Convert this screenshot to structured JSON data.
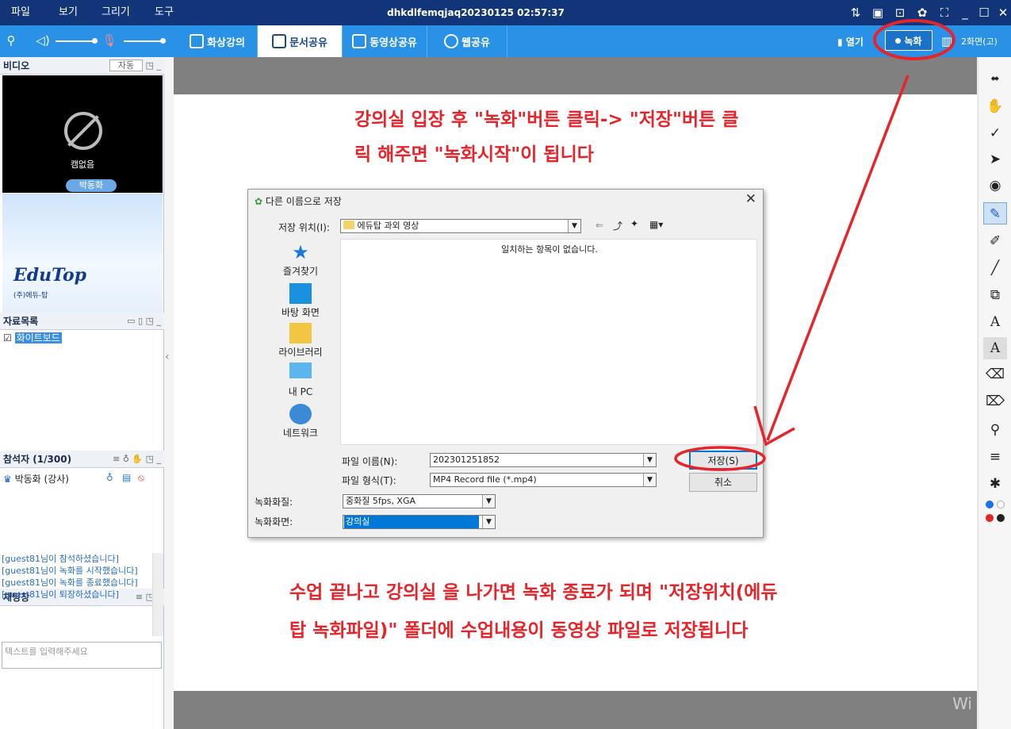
{
  "titlebar": {
    "menu": [
      "파일",
      "보기",
      "그리기",
      "도구"
    ],
    "title": "dhkdlfemqjaq20230125 02:57:37"
  },
  "toolbar": {
    "tabs": [
      "화상강의",
      "문서공유",
      "동영상공유",
      "웹공유"
    ],
    "active_tab": "문서공유",
    "open_label": "열기",
    "record_label": "녹화",
    "screen_label": "2화면(고)"
  },
  "video_panel": {
    "title": "비디오",
    "mode": "자동",
    "caption": "캠없음",
    "name": "박동화",
    "logo": "EduTop",
    "logo_sub": "(주)에듀-탑"
  },
  "materials_panel": {
    "title": "자료목록",
    "items": [
      "화이트보드"
    ]
  },
  "participants_panel": {
    "title": "참석자 (1/300)",
    "items": [
      "박동화 (강사)"
    ]
  },
  "chat_panel": {
    "title": "채팅창",
    "messages": [
      "[guest81님이 참석하셨습니다]",
      "[guest81님이 녹화를 시작했습니다]",
      "[guest81님이 녹화를 종료했습니다]",
      "[guest81님이 퇴장하셨습니다]"
    ],
    "input_placeholder": "텍스트를 입력해주세요"
  },
  "annotations": {
    "top_line1": "강의실 입장 후 \"녹화\"버튼 클릭-> \"저장\"버튼 클",
    "top_line2": "릭 해주면 \"녹화시작\"이 됩니다",
    "bottom_line1": "수업 끝나고 강의실 을 나가면 녹화 종료가 되며 \"저장위치(에듀",
    "bottom_line2": "탑 녹화파일)\" 폴더에 수업내용이 동영상 파일로 저장됩니다",
    "highlight_color": "#e8242b"
  },
  "save_dialog": {
    "title": "다른 이름으로 저장",
    "location_label": "저장 위치(I):",
    "location_value": "에듀탑 과외 영상",
    "empty_message": "일치하는 항목이 없습니다.",
    "places": [
      "즐겨찾기",
      "바탕 화면",
      "라이브러리",
      "내 PC",
      "네트워크"
    ],
    "filename_label": "파일 이름(N):",
    "filename_value": "202301251852",
    "filetype_label": "파일 형식(T):",
    "filetype_value": "MP4 Record file (*.mp4)",
    "quality_label": "녹화화질:",
    "quality_value": "중화질 5fps, XGA",
    "screen_label": "녹화화면:",
    "screen_value": "강의실",
    "save_button": "저장(S)",
    "cancel_button": "취소"
  },
  "watermark": "Wi"
}
